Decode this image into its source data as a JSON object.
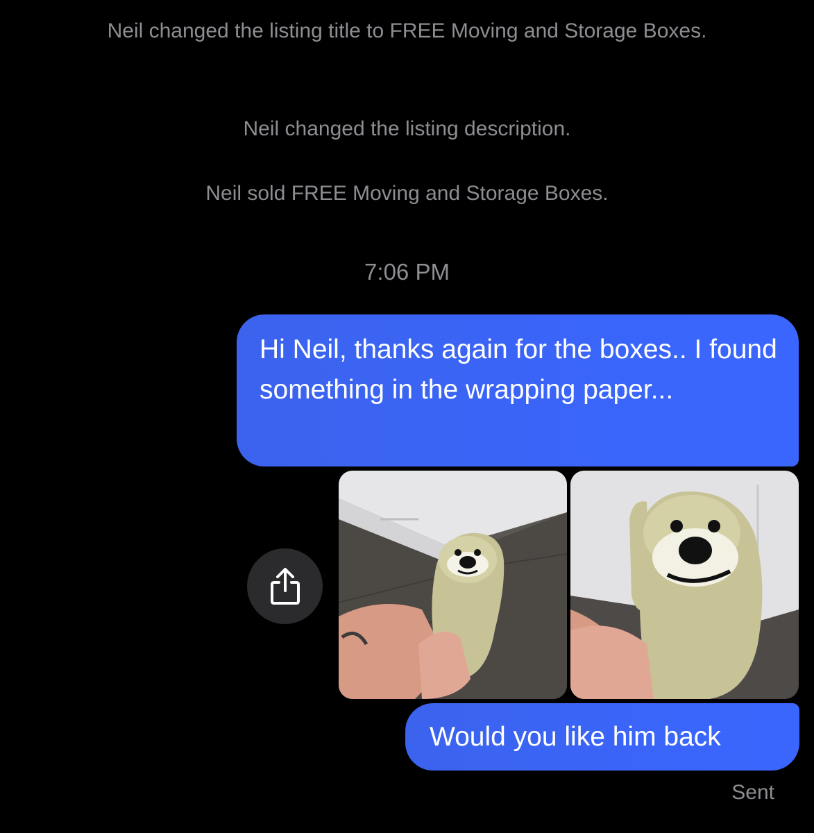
{
  "thread": {
    "system_messages": [
      "Neil changed the listing title to FREE Moving and Storage Boxes.",
      "Neil changed the listing description.",
      "Neil sold FREE Moving and Storage Boxes."
    ],
    "timestamp": "7:06 PM",
    "messages": [
      {
        "direction": "outgoing",
        "text": "Hi Neil, thanks again for the boxes.. I found something in the wrapping paper..."
      },
      {
        "direction": "outgoing",
        "type": "photos",
        "count": 2
      },
      {
        "direction": "outgoing",
        "text": "Would you like him back"
      }
    ],
    "status": "Sent"
  },
  "icons": {
    "share": "share-icon"
  },
  "colors": {
    "background": "#000000",
    "bubble": "#3a66ff",
    "meta_text": "#8d8d92",
    "share_button": "#2b2b2d"
  }
}
